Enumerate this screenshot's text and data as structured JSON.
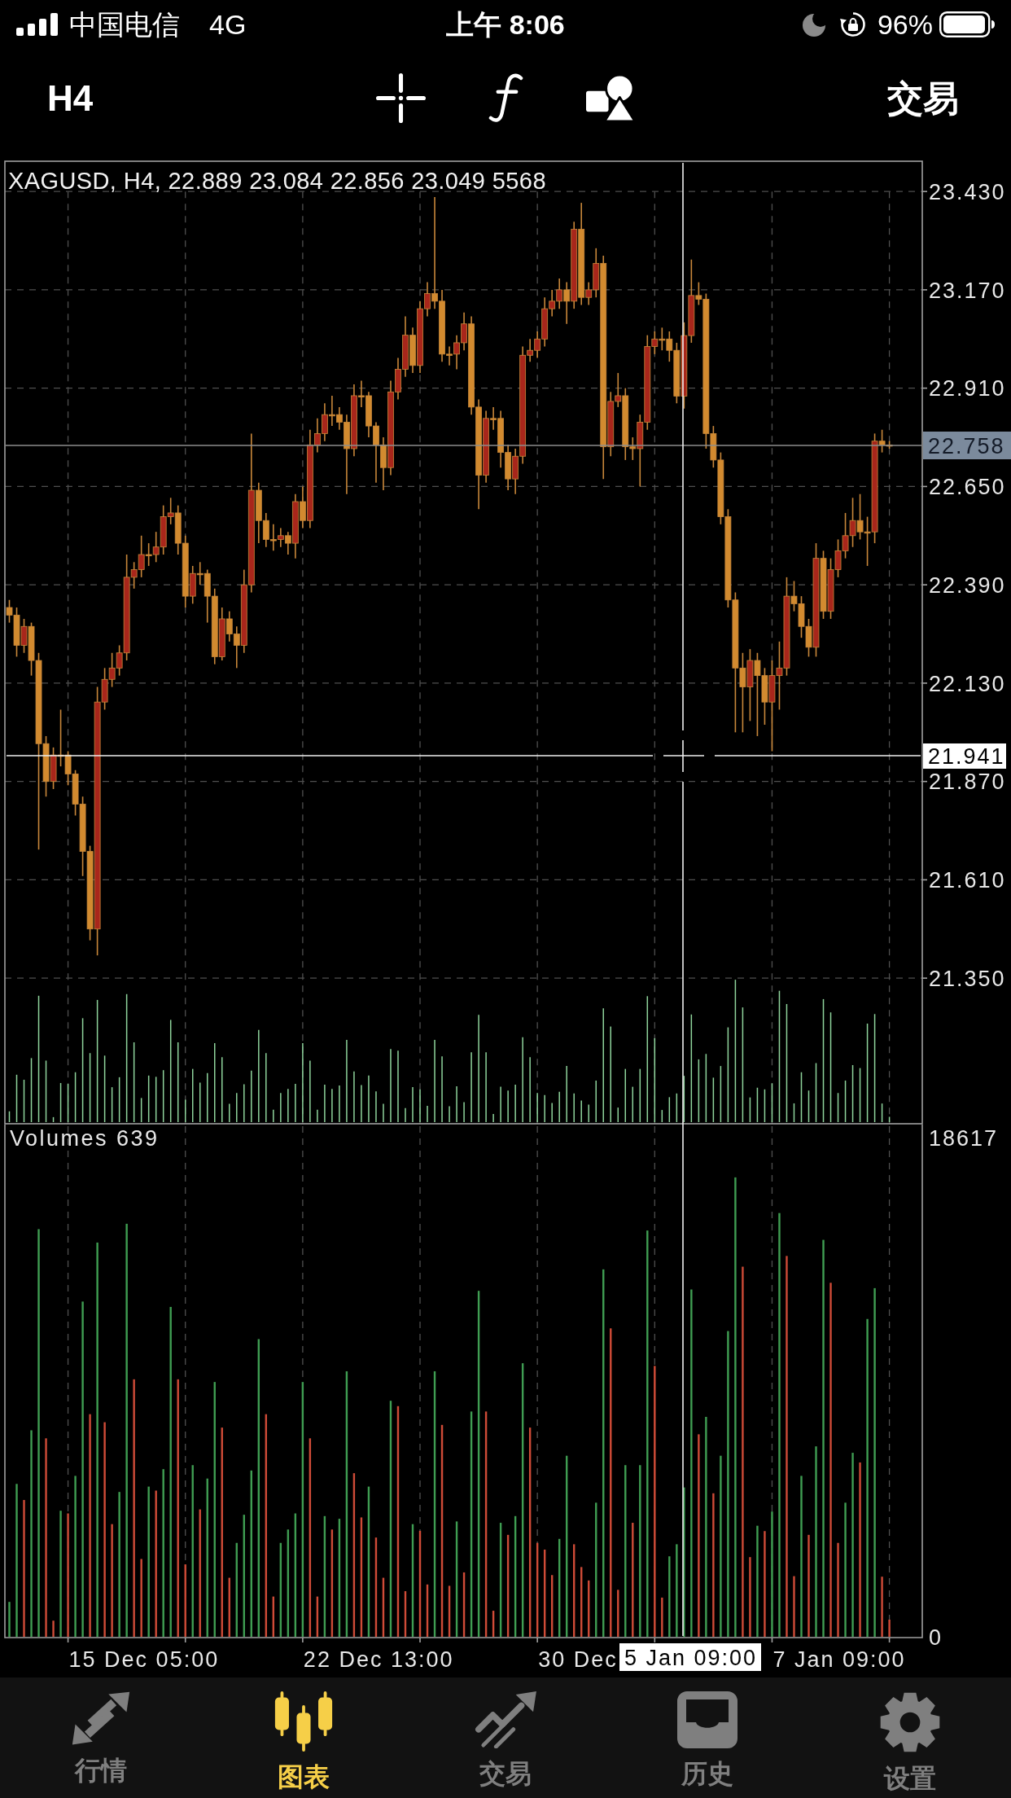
{
  "status_bar": {
    "carrier": "中国电信",
    "network": "4G",
    "time": "上午 8:06",
    "battery": "96%"
  },
  "toolbar": {
    "timeframe": "H4",
    "trade_button": "交易"
  },
  "price_chart": {
    "legend": "XAGUSD, H4, 22.889 23.084 22.856 23.049 5568",
    "current_price": "22.758",
    "crosshair_price": "21.941",
    "chart_data": {
      "type": "candlestick",
      "grid": true,
      "categories": [
        null,
        null,
        null,
        null,
        null,
        null,
        null,
        null,
        null,
        null,
        null,
        null,
        null,
        null,
        null,
        null,
        null,
        null,
        null,
        null,
        null,
        null,
        null,
        null,
        null,
        null,
        null,
        null,
        null,
        null,
        null,
        null,
        null,
        null,
        null,
        null,
        null,
        null,
        null,
        null,
        null,
        null,
        null,
        null,
        null,
        null,
        null,
        null,
        null,
        null,
        null,
        null,
        null,
        null,
        null,
        null,
        null,
        null,
        null,
        null,
        null,
        null,
        null,
        null,
        null,
        null,
        null,
        null,
        null,
        null,
        null,
        null,
        null,
        null,
        null,
        null,
        null,
        null,
        null,
        null,
        null,
        null,
        null,
        null,
        null,
        null,
        null,
        null,
        null,
        null,
        null,
        null,
        null,
        null,
        null,
        null,
        null,
        null,
        null,
        null,
        null,
        null,
        null,
        null,
        null,
        null,
        null,
        null,
        null,
        null,
        null,
        null,
        null,
        null,
        null,
        null,
        null,
        null,
        null,
        null,
        null
      ],
      "ohlc": [
        [
          22.33,
          22.35,
          22.29,
          22.31
        ],
        [
          22.31,
          22.33,
          22.2,
          22.23
        ],
        [
          22.23,
          22.3,
          22.21,
          22.28
        ],
        [
          22.28,
          22.29,
          22.15,
          22.19
        ],
        [
          22.19,
          22.21,
          21.69,
          21.97
        ],
        [
          21.97,
          21.99,
          21.83,
          21.87
        ],
        [
          21.87,
          21.96,
          21.85,
          21.94
        ],
        [
          21.94,
          22.06,
          21.91,
          21.94
        ],
        [
          21.94,
          21.95,
          21.86,
          21.89
        ],
        [
          21.89,
          21.9,
          21.78,
          21.81
        ],
        [
          21.81,
          21.83,
          21.62,
          21.685
        ],
        [
          21.685,
          21.7,
          21.45,
          21.48
        ],
        [
          21.48,
          22.12,
          21.41,
          22.08
        ],
        [
          22.08,
          22.17,
          22.06,
          22.14
        ],
        [
          22.14,
          22.21,
          22.12,
          22.17
        ],
        [
          22.17,
          22.23,
          22.15,
          22.21
        ],
        [
          22.21,
          22.47,
          22.19,
          22.41
        ],
        [
          22.41,
          22.45,
          22.38,
          22.43
        ],
        [
          22.43,
          22.52,
          22.41,
          22.47
        ],
        [
          22.47,
          22.5,
          22.44,
          22.47
        ],
        [
          22.47,
          22.53,
          22.45,
          22.49
        ],
        [
          22.49,
          22.6,
          22.47,
          22.57
        ],
        [
          22.57,
          22.62,
          22.55,
          22.58
        ],
        [
          22.58,
          22.6,
          22.47,
          22.5
        ],
        [
          22.5,
          22.52,
          22.33,
          22.36
        ],
        [
          22.36,
          22.44,
          22.34,
          22.42
        ],
        [
          22.42,
          22.45,
          22.39,
          22.42
        ],
        [
          22.42,
          22.43,
          22.29,
          22.36
        ],
        [
          22.36,
          22.38,
          22.18,
          22.2
        ],
        [
          22.2,
          22.33,
          22.19,
          22.3
        ],
        [
          22.3,
          22.32,
          22.24,
          22.26
        ],
        [
          22.26,
          22.28,
          22.17,
          22.23
        ],
        [
          22.23,
          22.43,
          22.21,
          22.39
        ],
        [
          22.39,
          22.79,
          22.37,
          22.64
        ],
        [
          22.64,
          22.66,
          22.5,
          22.56
        ],
        [
          22.56,
          22.58,
          22.49,
          22.51
        ],
        [
          22.51,
          22.55,
          22.48,
          22.51
        ],
        [
          22.51,
          22.54,
          22.49,
          22.52
        ],
        [
          22.52,
          22.53,
          22.47,
          22.5
        ],
        [
          22.5,
          22.63,
          22.46,
          22.61
        ],
        [
          22.61,
          22.65,
          22.54,
          22.56
        ],
        [
          22.56,
          22.8,
          22.54,
          22.76
        ],
        [
          22.76,
          22.83,
          22.74,
          22.79
        ],
        [
          22.79,
          22.87,
          22.77,
          22.84
        ],
        [
          22.84,
          22.89,
          22.81,
          22.84
        ],
        [
          22.84,
          22.86,
          22.8,
          22.82
        ],
        [
          22.82,
          22.84,
          22.63,
          22.75
        ],
        [
          22.75,
          22.92,
          22.73,
          22.89
        ],
        [
          22.89,
          22.93,
          22.86,
          22.89
        ],
        [
          22.89,
          22.9,
          22.78,
          22.81
        ],
        [
          22.81,
          22.82,
          22.66,
          22.76
        ],
        [
          22.76,
          22.78,
          22.64,
          22.7
        ],
        [
          22.7,
          22.93,
          22.68,
          22.9
        ],
        [
          22.9,
          22.99,
          22.88,
          22.96
        ],
        [
          22.96,
          23.1,
          22.94,
          23.05
        ],
        [
          23.05,
          23.07,
          22.95,
          22.97
        ],
        [
          22.97,
          23.14,
          22.95,
          23.12
        ],
        [
          23.12,
          23.19,
          23.1,
          23.16
        ],
        [
          23.16,
          23.415,
          23.12,
          23.14
        ],
        [
          23.14,
          23.17,
          22.98,
          23.0
        ],
        [
          23.0,
          23.02,
          22.97,
          23.0
        ],
        [
          23.0,
          23.05,
          22.96,
          23.03
        ],
        [
          23.03,
          23.11,
          23.01,
          23.08
        ],
        [
          23.08,
          23.1,
          22.84,
          22.86
        ],
        [
          22.86,
          22.88,
          22.59,
          22.68
        ],
        [
          22.68,
          22.85,
          22.66,
          22.83
        ],
        [
          22.83,
          22.86,
          22.8,
          22.83
        ],
        [
          22.83,
          22.85,
          22.7,
          22.74
        ],
        [
          22.74,
          22.76,
          22.64,
          22.67
        ],
        [
          22.67,
          22.75,
          22.63,
          22.73
        ],
        [
          22.73,
          23.02,
          22.71,
          22.997
        ],
        [
          22.997,
          23.04,
          22.98,
          23.01
        ],
        [
          23.01,
          23.06,
          22.99,
          23.04
        ],
        [
          23.04,
          23.15,
          23.02,
          23.12
        ],
        [
          23.12,
          23.17,
          23.1,
          23.14
        ],
        [
          23.14,
          23.2,
          23.12,
          23.17
        ],
        [
          23.17,
          23.19,
          23.08,
          23.14
        ],
        [
          23.14,
          23.35,
          23.12,
          23.33
        ],
        [
          23.33,
          23.4,
          23.13,
          23.15
        ],
        [
          23.15,
          23.19,
          23.13,
          23.17
        ],
        [
          23.17,
          23.28,
          23.15,
          23.24
        ],
        [
          23.24,
          23.26,
          22.67,
          22.755
        ],
        [
          22.755,
          22.9,
          22.73,
          22.875
        ],
        [
          22.875,
          22.95,
          22.86,
          22.89
        ],
        [
          22.89,
          22.91,
          22.72,
          22.755
        ],
        [
          22.755,
          22.78,
          22.72,
          22.75
        ],
        [
          22.75,
          22.84,
          22.65,
          22.82
        ],
        [
          22.82,
          23.05,
          22.8,
          23.02
        ],
        [
          23.02,
          23.06,
          23.0,
          23.04
        ],
        [
          23.04,
          23.07,
          23.01,
          23.04
        ],
        [
          23.04,
          23.06,
          22.98,
          23.01
        ],
        [
          23.01,
          23.03,
          22.87,
          22.889
        ],
        [
          22.889,
          23.084,
          22.856,
          23.049
        ],
        [
          23.049,
          23.25,
          23.03,
          23.155
        ],
        [
          23.155,
          23.19,
          23.13,
          23.145
        ],
        [
          23.145,
          23.16,
          22.75,
          22.79
        ],
        [
          22.79,
          22.81,
          22.7,
          22.72
        ],
        [
          22.72,
          22.74,
          22.55,
          22.57
        ],
        [
          22.57,
          22.59,
          22.33,
          22.35
        ],
        [
          22.35,
          22.37,
          22.0,
          22.17
        ],
        [
          22.17,
          22.21,
          22.0,
          22.12
        ],
        [
          22.12,
          22.22,
          22.03,
          22.19
        ],
        [
          22.19,
          22.21,
          21.99,
          22.15
        ],
        [
          22.15,
          22.17,
          22.02,
          22.08
        ],
        [
          22.08,
          22.19,
          21.95,
          22.15
        ],
        [
          22.15,
          22.24,
          22.06,
          22.17
        ],
        [
          22.17,
          22.41,
          22.15,
          22.36
        ],
        [
          22.36,
          22.4,
          22.32,
          22.34
        ],
        [
          22.34,
          22.36,
          22.25,
          22.28
        ],
        [
          22.28,
          22.3,
          22.2,
          22.225
        ],
        [
          22.225,
          22.5,
          22.2,
          22.46
        ],
        [
          22.46,
          22.48,
          22.3,
          22.32
        ],
        [
          22.32,
          22.46,
          22.3,
          22.43
        ],
        [
          22.43,
          22.51,
          22.41,
          22.48
        ],
        [
          22.48,
          22.58,
          22.46,
          22.52
        ],
        [
          22.52,
          22.62,
          22.49,
          22.56
        ],
        [
          22.56,
          22.63,
          22.51,
          22.53
        ],
        [
          22.53,
          22.57,
          22.44,
          22.53
        ],
        [
          22.53,
          22.79,
          22.5,
          22.77
        ],
        [
          22.77,
          22.8,
          22.74,
          22.76
        ],
        [
          22.76,
          22.77,
          22.75,
          22.758
        ]
      ],
      "ylim": [
        20.965,
        23.51
      ],
      "yticks": [
        {
          "value": 23.43,
          "label": "23.430"
        },
        {
          "value": 23.17,
          "label": "23.170"
        },
        {
          "value": 22.91,
          "label": "22.910"
        },
        {
          "value": 22.65,
          "label": "22.650"
        },
        {
          "value": 22.39,
          "label": "22.390"
        },
        {
          "value": 22.13,
          "label": "22.130"
        },
        {
          "value": 21.87,
          "label": "21.870"
        },
        {
          "value": 21.61,
          "label": "21.610"
        },
        {
          "value": 21.35,
          "label": "21.350"
        }
      ]
    }
  },
  "volume_chart": {
    "legend": "Volumes 639",
    "time_axis": [
      "15 Dec 05:00",
      "22 Dec 13:00",
      "30 Dec",
      "7 Jan 09:00"
    ],
    "crosshair_time": "5 Jan 09:00",
    "chart_data": {
      "type": "bar",
      "grid": true,
      "categories": [
        null,
        null,
        null,
        null,
        null,
        null,
        null,
        null,
        null,
        null,
        null,
        null,
        null,
        null,
        null,
        null,
        null,
        null,
        null,
        null,
        null,
        null,
        null,
        null,
        null,
        null,
        null,
        null,
        null,
        null,
        null,
        null,
        null,
        null,
        null,
        null,
        null,
        null,
        null,
        null,
        null,
        null,
        null,
        null,
        null,
        null,
        null,
        null,
        null,
        null,
        null,
        null,
        null,
        null,
        null,
        null,
        null,
        null,
        null,
        null,
        null,
        null,
        null,
        null,
        null,
        null,
        null,
        null,
        null,
        null,
        null,
        null,
        null,
        null,
        null,
        null,
        null,
        null,
        null,
        null,
        null,
        null,
        null,
        null,
        null,
        null,
        null,
        null,
        null,
        null,
        null,
        null,
        null,
        null,
        null,
        null,
        null,
        null,
        null,
        null,
        null,
        null,
        null,
        null,
        null,
        null,
        null,
        null,
        null,
        null,
        null,
        null,
        null,
        null,
        null,
        null,
        null,
        null,
        null,
        null,
        null
      ],
      "values": [
        1300,
        5700,
        5100,
        7700,
        15200,
        7400,
        600,
        4700,
        4600,
        6000,
        12500,
        8300,
        14700,
        8000,
        4200,
        5400,
        15400,
        9600,
        2900,
        5600,
        5450,
        6250,
        12300,
        9600,
        2700,
        6400,
        4750,
        5900,
        9500,
        7800,
        2200,
        3500,
        4550,
        6200,
        11100,
        8300,
        1500,
        3500,
        4000,
        4600,
        9500,
        7400,
        1500,
        4500,
        4000,
        4400,
        9900,
        6100,
        4450,
        5600,
        3700,
        2200,
        8800,
        8600,
        1700,
        4200,
        3950,
        1950,
        9900,
        7900,
        1900,
        4300,
        2400,
        8400,
        12900,
        8400,
        970,
        4250,
        3800,
        4500,
        10200,
        7800,
        3500,
        3250,
        2300,
        3650,
        6750,
        3450,
        2600,
        2100,
        5000,
        13700,
        11500,
        1750,
        6400,
        4250,
        6400,
        15150,
        10100,
        1460,
        3000,
        3450,
        5568,
        12950,
        7550,
        8200,
        5350,
        6750,
        11400,
        17130,
        13800,
        2970,
        4140,
        3940,
        4670,
        15800,
        14200,
        2260,
        6000,
        3800,
        7100,
        14800,
        13200,
        3500,
        5000,
        6860,
        6500,
        11850,
        13000,
        2240,
        639
      ],
      "ylim": [
        0,
        19100
      ],
      "yticks": [
        {
          "value": 18617,
          "label": "18617"
        },
        {
          "value": 0,
          "label": "0"
        }
      ]
    }
  },
  "tab_bar": [
    {
      "label": "行情",
      "selected": false
    },
    {
      "label": "图表",
      "selected": true
    },
    {
      "label": "交易",
      "selected": false
    },
    {
      "label": "历史",
      "selected": false
    },
    {
      "label": "设置",
      "selected": false
    }
  ]
}
